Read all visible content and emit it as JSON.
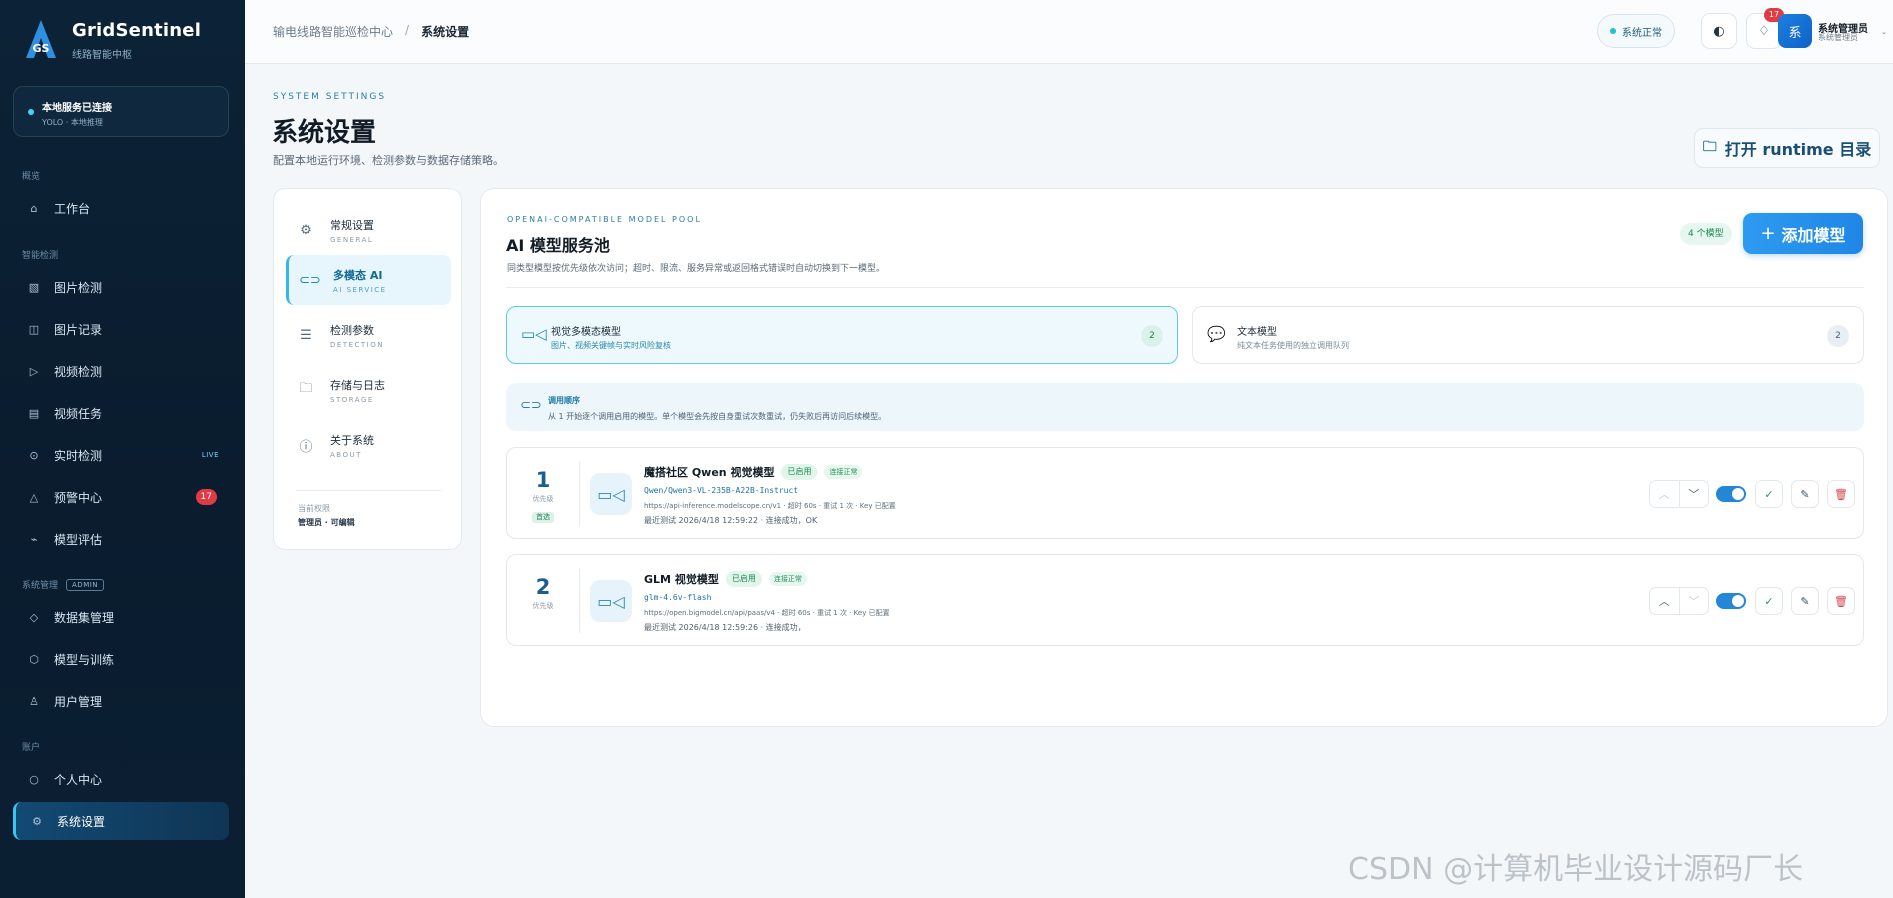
{
  "sidebar": {
    "brand_title": "GridSentinel",
    "brand_sub": "线路智能中枢",
    "logo_text": "GS",
    "status_title": "本地服务已连接",
    "status_sub": "YOLO · 本地推理",
    "sections": {
      "overview": "概览",
      "detection": "智能检测",
      "system": "系统管理",
      "system_badge": "ADMIN",
      "account": "账户"
    },
    "items": [
      {
        "label": "工作台",
        "icon": "home-icon"
      },
      {
        "label": "图片检测",
        "icon": "image-icon"
      },
      {
        "label": "图片记录",
        "icon": "records-icon"
      },
      {
        "label": "视频检测",
        "icon": "play-icon"
      },
      {
        "label": "视频任务",
        "icon": "list-icon"
      },
      {
        "label": "实时检测",
        "icon": "target-icon",
        "tag": "LIVE"
      },
      {
        "label": "预警中心",
        "icon": "warning-icon",
        "badge": "17"
      },
      {
        "label": "模型评估",
        "icon": "chart-icon"
      },
      {
        "label": "数据集管理",
        "icon": "dataset-icon"
      },
      {
        "label": "模型与训练",
        "icon": "cube-icon"
      },
      {
        "label": "用户管理",
        "icon": "users-icon"
      },
      {
        "label": "个人中心",
        "icon": "user-icon"
      },
      {
        "label": "系统设置",
        "icon": "gear-icon"
      }
    ]
  },
  "topbar": {
    "breadcrumb_root": "输电线路智能巡检中心",
    "breadcrumb_sep": "/",
    "breadcrumb_current": "系统设置",
    "system_status": "系统正常",
    "notification_count": "17",
    "avatar_text": "系",
    "user_name": "系统管理员",
    "user_role": "系统管理员"
  },
  "page": {
    "eyebrow": "SYSTEM SETTINGS",
    "title": "系统设置",
    "description": "配置本地运行环境、检测参数与数据存储策略。",
    "runtime_button": "打开 runtime 目录"
  },
  "settings_nav": {
    "items": [
      {
        "label": "常规设置",
        "sub": "GENERAL",
        "icon": "gear-icon"
      },
      {
        "label": "多模态 AI",
        "sub": "AI SERVICE",
        "icon": "link-icon"
      },
      {
        "label": "检测参数",
        "sub": "DETECTION",
        "icon": "sliders-icon"
      },
      {
        "label": "存储与日志",
        "sub": "STORAGE",
        "icon": "folder-icon"
      },
      {
        "label": "关于系统",
        "sub": "ABOUT",
        "icon": "info-icon"
      }
    ],
    "footer_label": "当前权限",
    "footer_value": "管理员 · 可编辑"
  },
  "pool": {
    "eyebrow": "OPENAI-COMPATIBLE MODEL POOL",
    "title": "AI 模型服务池",
    "description": "同类型模型按优先级依次访问；超时、限流、服务异常或返回格式错误时自动切换到下一模型。",
    "count_badge": "4 个模型",
    "add_button": "添加模型",
    "type_cards": [
      {
        "title": "视觉多模态模型",
        "sub": "图片、视频关键帧与实时风险复核",
        "count": "2"
      },
      {
        "title": "文本模型",
        "sub": "纯文本任务使用的独立调用队列",
        "count": "2"
      }
    ],
    "order_title": "调用顺序",
    "order_desc": "从 1 开始逐个调用启用的模型。单个模型会先按自身重试次数重试，仍失败后再访问后续模型。",
    "models": [
      {
        "priority": "1",
        "priority_label": "优先级",
        "priority_tag": "首选",
        "name": "魔搭社区 Qwen 视觉模型",
        "status": "已启用",
        "test_tag": "连接正常",
        "model_id": "Qwen/Qwen3-VL-235B-A22B-Instruct",
        "meta": "https://api-inference.modelscope.cn/v1 · 超时 60s · 重试 1 次 · Key 已配置",
        "last_test": "最近测试 2026/4/18 12:59:22 · 连接成功，OK"
      },
      {
        "priority": "2",
        "priority_label": "优先级",
        "name": "GLM 视觉模型",
        "status": "已启用",
        "test_tag": "连接正常",
        "model_id": "glm-4.6v-flash",
        "meta": "https://open.bigmodel.cn/api/paas/v4 · 超时 60s · 重试 1 次 · Key 已配置",
        "last_test": "最近测试 2026/4/18 12:59:26 · 连接成功，"
      }
    ]
  },
  "watermark": "CSDN @计算机毕业设计源码厂长"
}
